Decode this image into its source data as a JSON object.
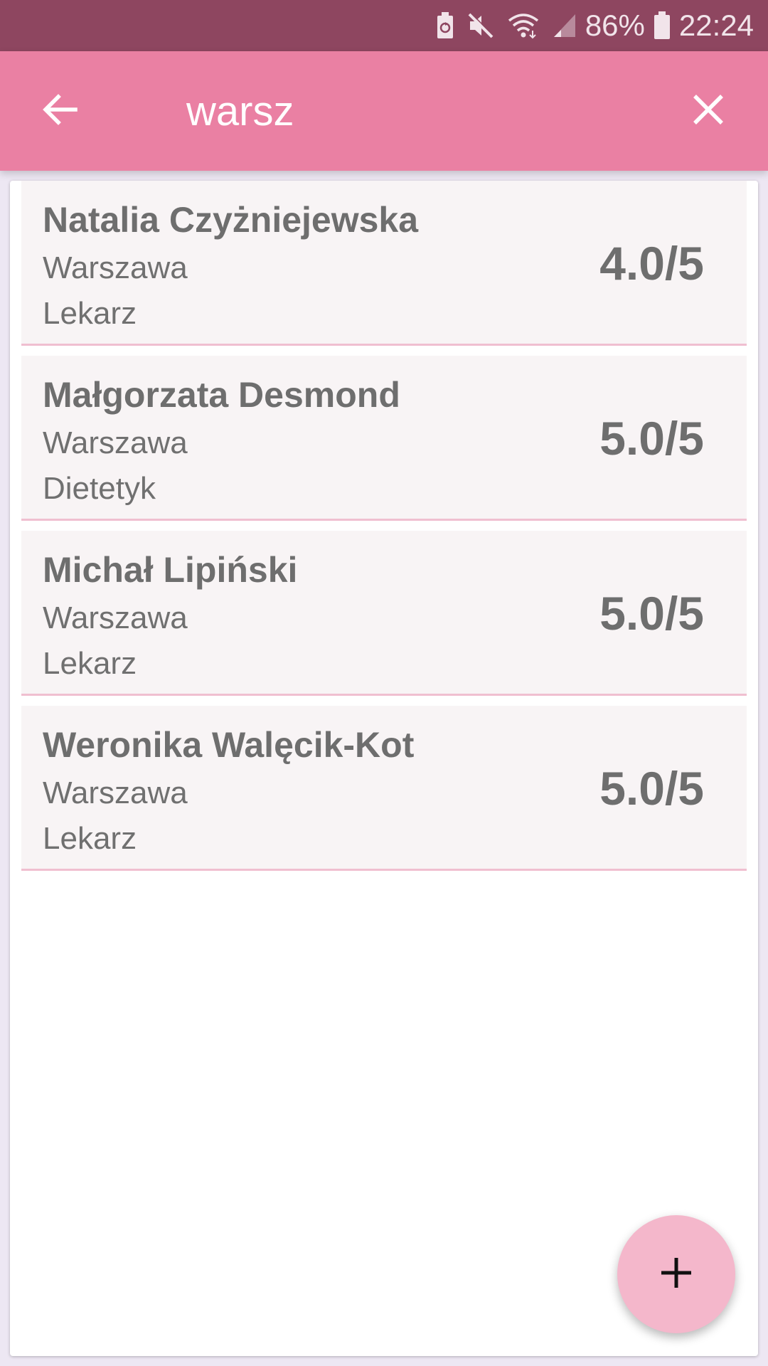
{
  "status_bar": {
    "battery_saver_icon": "battery-recycle-icon",
    "mute_icon": "volume-mute-icon",
    "wifi_icon": "wifi-icon",
    "signal_icon": "cellular-signal-icon",
    "battery_percent": "86%",
    "battery_icon": "battery-icon",
    "time": "22:24"
  },
  "app_bar": {
    "search_value": "warsz",
    "back_icon": "arrow-back-icon",
    "clear_icon": "close-icon"
  },
  "results": [
    {
      "name": "Natalia Czyżniejewska",
      "city": "Warszawa",
      "role": "Lekarz",
      "rating": "4.0/5"
    },
    {
      "name": "Małgorzata Desmond",
      "city": "Warszawa",
      "role": "Dietetyk",
      "rating": "5.0/5"
    },
    {
      "name": "Michał Lipiński",
      "city": "Warszawa",
      "role": "Lekarz",
      "rating": "5.0/5"
    },
    {
      "name": "Weronika Walęcik-Kot",
      "city": "Warszawa",
      "role": "Lekarz",
      "rating": "5.0/5"
    }
  ],
  "fab": {
    "icon": "plus-icon"
  },
  "colors": {
    "status_bar": "#8e4660",
    "app_bar": "#ea80a3",
    "fab": "#f4b7cb",
    "row_divider": "#f0bfd0",
    "row_background": "#f8f4f5",
    "text_gray": "#6e6e6e"
  }
}
